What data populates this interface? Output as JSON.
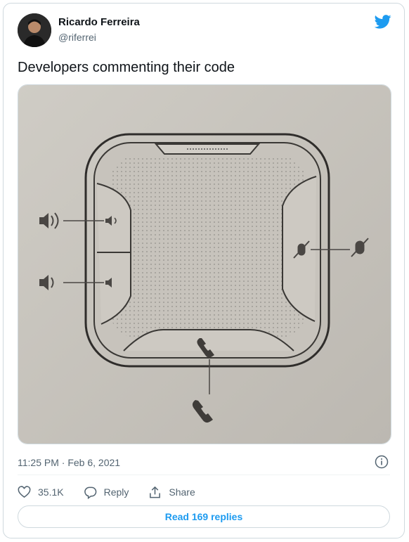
{
  "author": {
    "name": "Ricardo Ferreira",
    "handle": "@riferrei",
    "avatar_icon": "avatar-photo"
  },
  "brand": {
    "icon": "twitter-bird-icon",
    "color": "#1d9bf0"
  },
  "tweet": {
    "text": "Developers commenting their code",
    "timestamp": "11:25 PM · Feb 6, 2021"
  },
  "actions": {
    "like_count": "35.1K",
    "reply_label": "Reply",
    "share_label": "Share"
  },
  "read_replies_label": "Read 169 replies"
}
